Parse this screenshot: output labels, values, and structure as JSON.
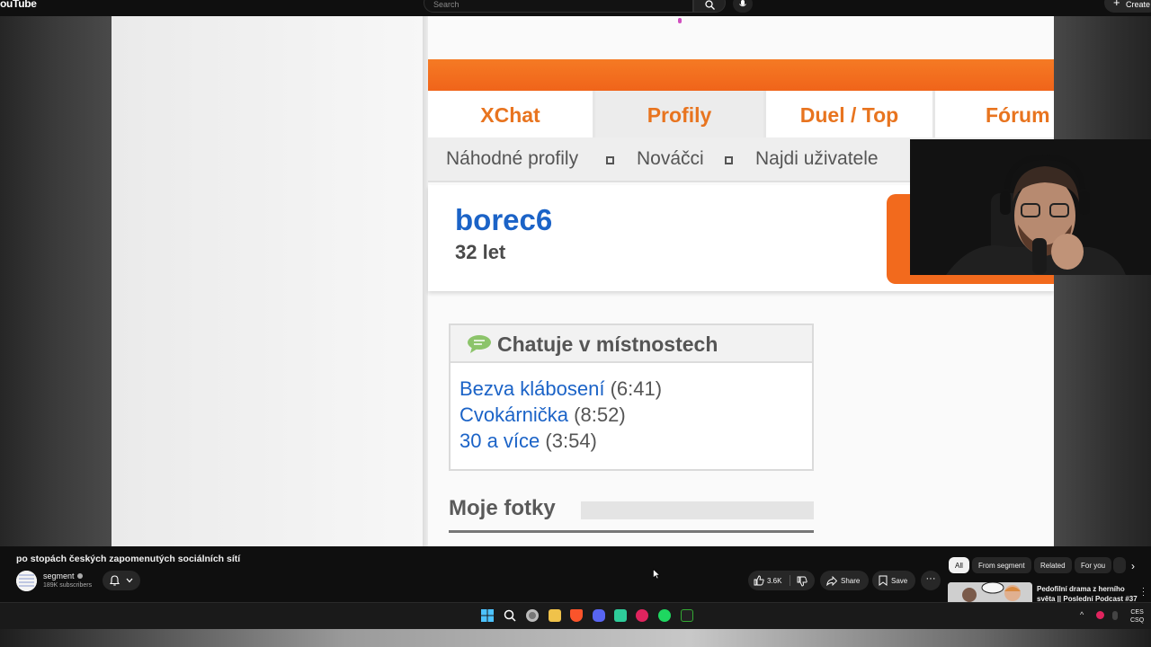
{
  "app": {
    "logo": "ouTube",
    "search_placeholder": "Search",
    "create_label": "Create"
  },
  "video_content": {
    "tabs": [
      "XChat",
      "Profily",
      "Duel / Top",
      "Fórum"
    ],
    "subnav": [
      "Náhodné profily",
      "Nováčci",
      "Najdi uživatele"
    ],
    "username": "borec6",
    "age": "32 let",
    "chat_box_title": "Chatuje v místnostech",
    "rooms": [
      {
        "name": "Bezva klábosení",
        "time": "(6:41)"
      },
      {
        "name": "Cvokárnička",
        "time": "(8:52)"
      },
      {
        "name": "30 a více",
        "time": "(3:54)"
      }
    ],
    "photos_title": "Moje fotky"
  },
  "video_info": {
    "title": "po stopách českých zapomenutých sociálních sítí",
    "channel": "segment",
    "subscribers": "189K subscribers",
    "likes": "3.6K",
    "share_label": "Share",
    "save_label": "Save"
  },
  "sidebar": {
    "chips": [
      "All",
      "From segment",
      "Related",
      "For you"
    ],
    "recommended": [
      {
        "title": "Pedofilní drama z herního světa || Poslední Podcast #37"
      }
    ]
  },
  "taskbar": {
    "language": "CES",
    "layout": "CSQ"
  }
}
